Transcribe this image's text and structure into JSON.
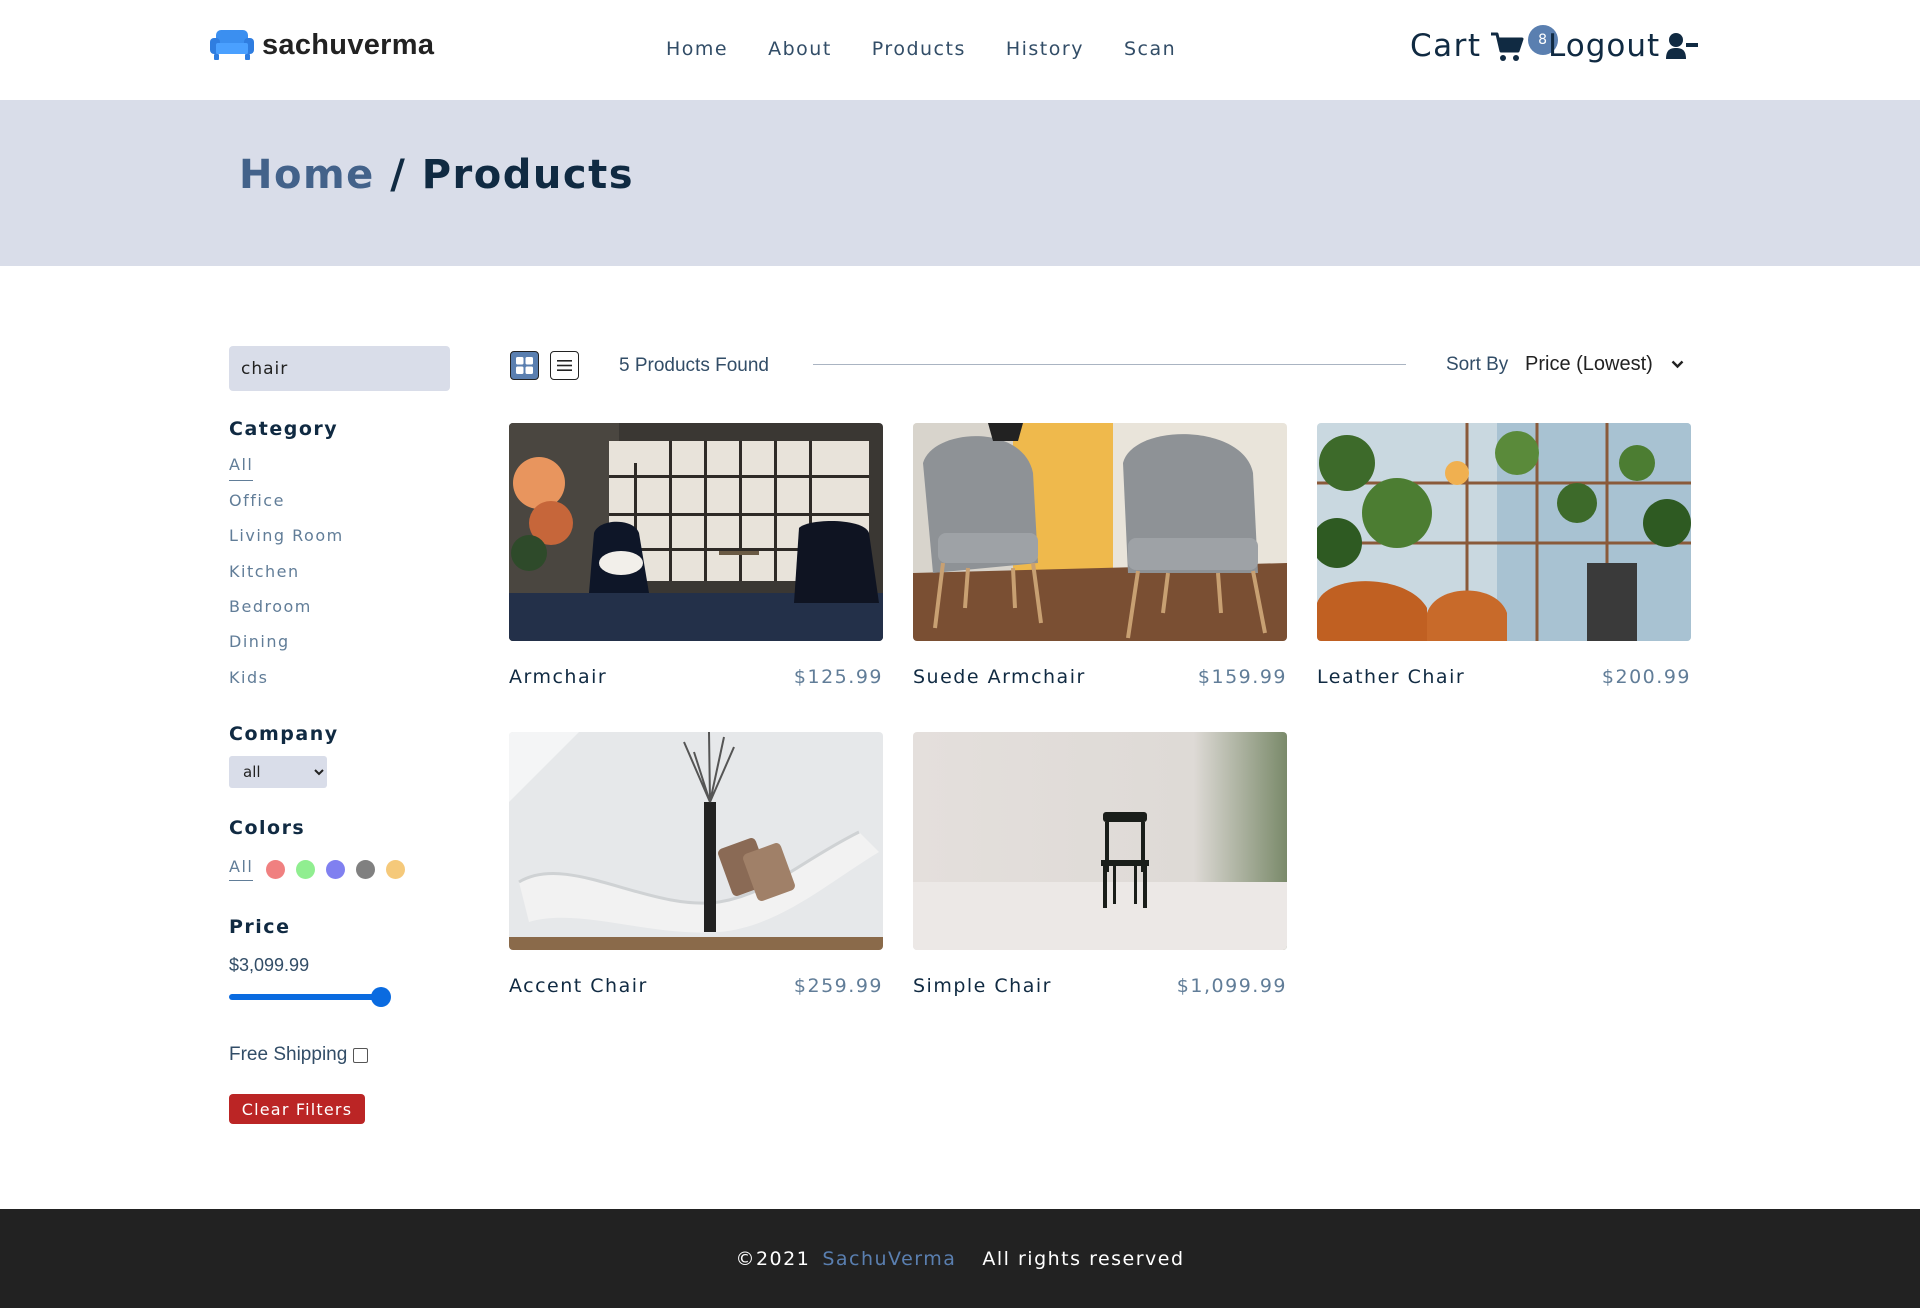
{
  "navbar": {
    "brand": "sachuverma",
    "links": [
      "Home",
      "About",
      "Products",
      "History",
      "Scan"
    ],
    "cart_label": "Cart",
    "cart_count": "8",
    "logout_label": "Logout",
    "icons": [
      "sofa-icon",
      "cart-icon",
      "user-minus-icon"
    ]
  },
  "hero": {
    "home": "Home",
    "separator": " / ",
    "current": "Products"
  },
  "filters": {
    "search_value": "chair",
    "category_title": "Category",
    "categories": [
      "All",
      "Office",
      "Living Room",
      "Kitchen",
      "Bedroom",
      "Dining",
      "Kids"
    ],
    "company_title": "Company",
    "company_selected": "all",
    "colors_title": "Colors",
    "colors_all": "All",
    "colors": [
      "#f08080",
      "#90ee90",
      "#8080f0",
      "#808080",
      "#f5c97a"
    ],
    "price_title": "Price",
    "price_value": "$3,099.99",
    "price_fraction": 1.0,
    "shipping_label": "Free Shipping",
    "clear_label": "Clear Filters"
  },
  "toolbar": {
    "found": "5 Products Found",
    "sort_label": "Sort By",
    "sort_value": "Price (Lowest)"
  },
  "products": [
    {
      "name": "Armchair",
      "price": "$125.99"
    },
    {
      "name": "Suede Armchair",
      "price": "$159.99"
    },
    {
      "name": "Leather Chair",
      "price": "$200.99"
    },
    {
      "name": "Accent Chair",
      "price": "$259.99"
    },
    {
      "name": "Simple Chair",
      "price": "$1,099.99"
    }
  ],
  "footer": {
    "copyright": "©2021",
    "brand": "SachuVerma",
    "rights": "All rights reserved"
  },
  "colors": {
    "accent": "#5a7fb0",
    "hero_bg": "#d9dde9",
    "danger": "#bb2525",
    "slider": "#0a6be0",
    "footer_bg": "#222222"
  }
}
